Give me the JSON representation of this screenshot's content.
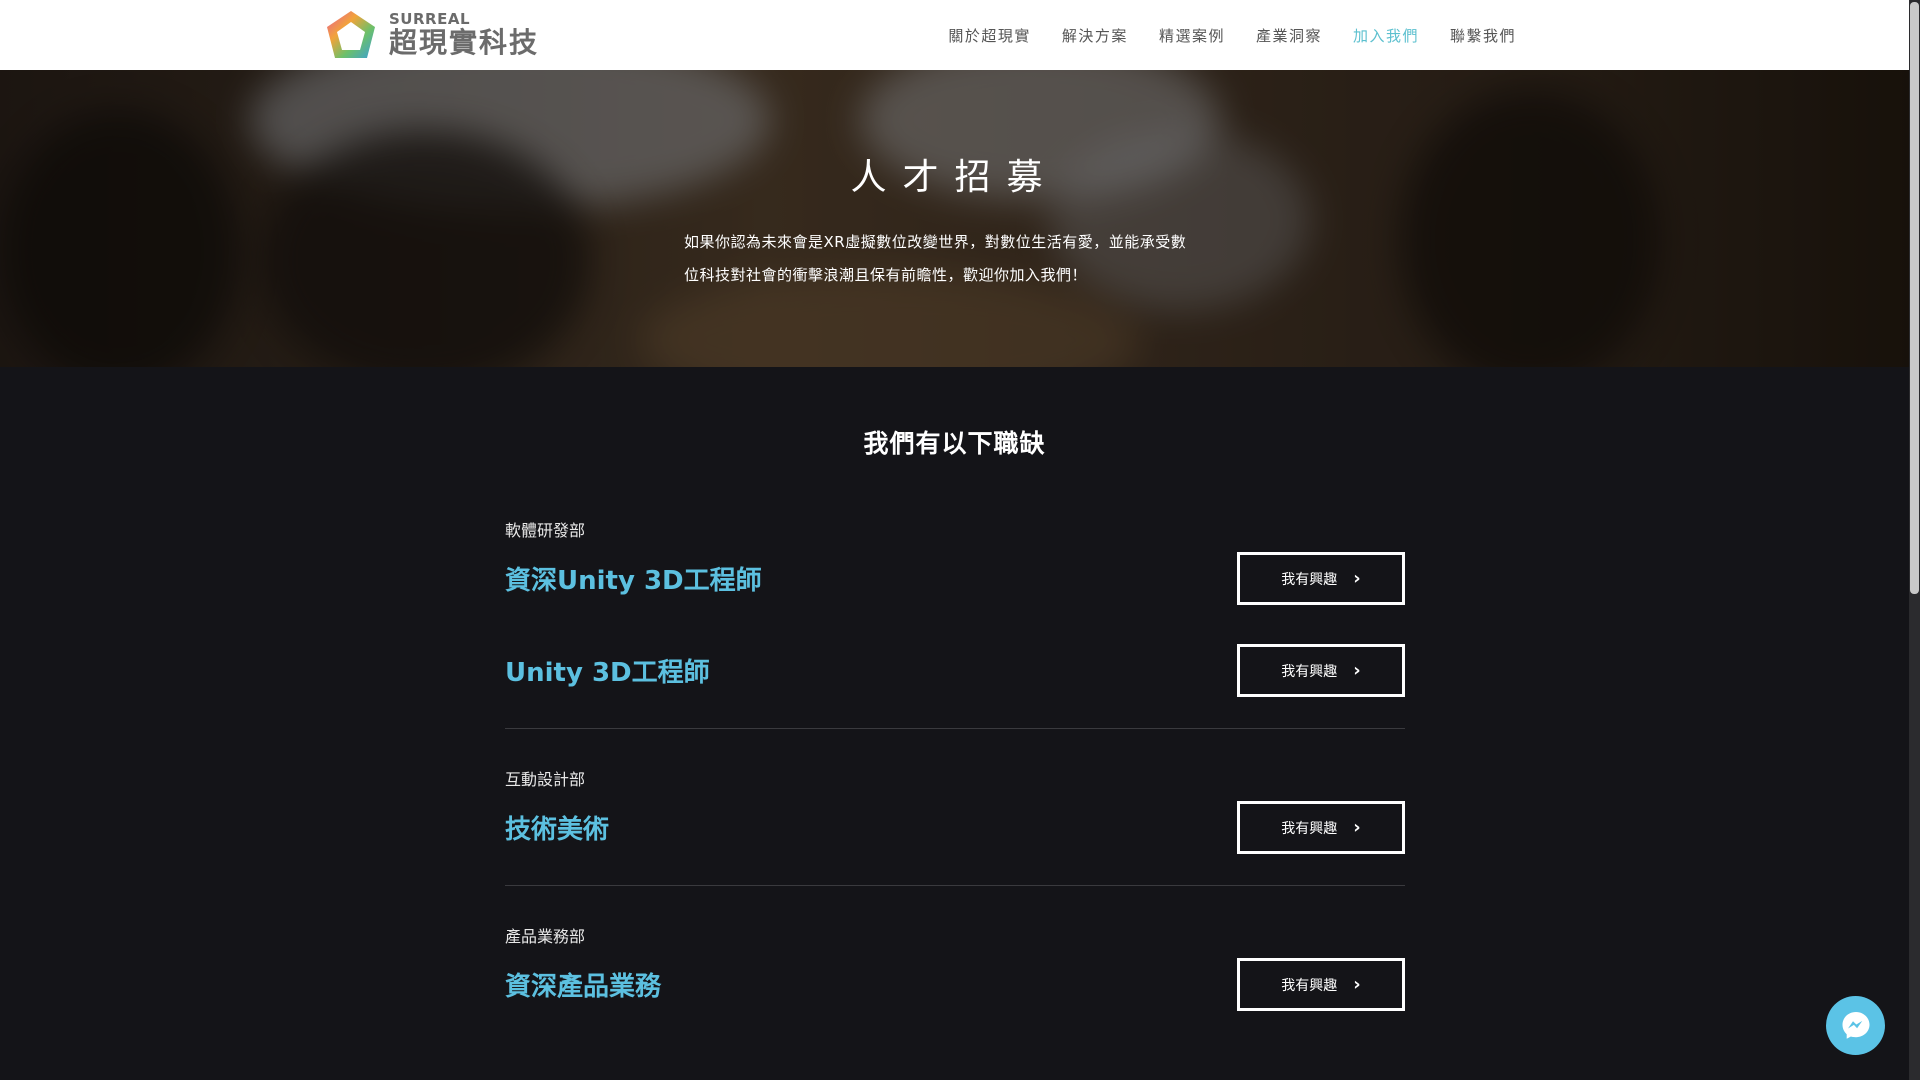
{
  "brand": {
    "name_en": "SURREAL",
    "name_zh": "超現實科技"
  },
  "nav": {
    "items": [
      {
        "label": "關於超現實"
      },
      {
        "label": "解決方案"
      },
      {
        "label": "精選案例"
      },
      {
        "label": "產業洞察"
      },
      {
        "label": "加入我們",
        "active": true
      },
      {
        "label": "聯繫我們"
      }
    ]
  },
  "hero": {
    "title": "人才招募",
    "text_line1": "如果你認為未來會是XR虛擬數位改變世界，對數位生活有愛，並能承受數",
    "text_line2": "位科技對社會的衝擊浪潮且保有前瞻性，歡迎你加入我們！"
  },
  "jobs_section": {
    "title": "我們有以下職缺",
    "button_label": "我有興趣",
    "departments": [
      {
        "name": "軟體研發部",
        "jobs": [
          {
            "title": "資深Unity 3D工程師"
          },
          {
            "title": "Unity 3D工程師"
          }
        ]
      },
      {
        "name": "互動設計部",
        "jobs": [
          {
            "title": "技術美術"
          }
        ]
      },
      {
        "name": "產品業務部",
        "jobs": [
          {
            "title": "資深產品業務"
          }
        ]
      }
    ]
  },
  "colors": {
    "accent": "#5cc0cf",
    "job_title": "#5cc0e0",
    "background": "#141418",
    "messenger": "#5bc3e6"
  },
  "icons": {
    "chevron": "chevron-right-icon",
    "messenger": "messenger-icon"
  }
}
